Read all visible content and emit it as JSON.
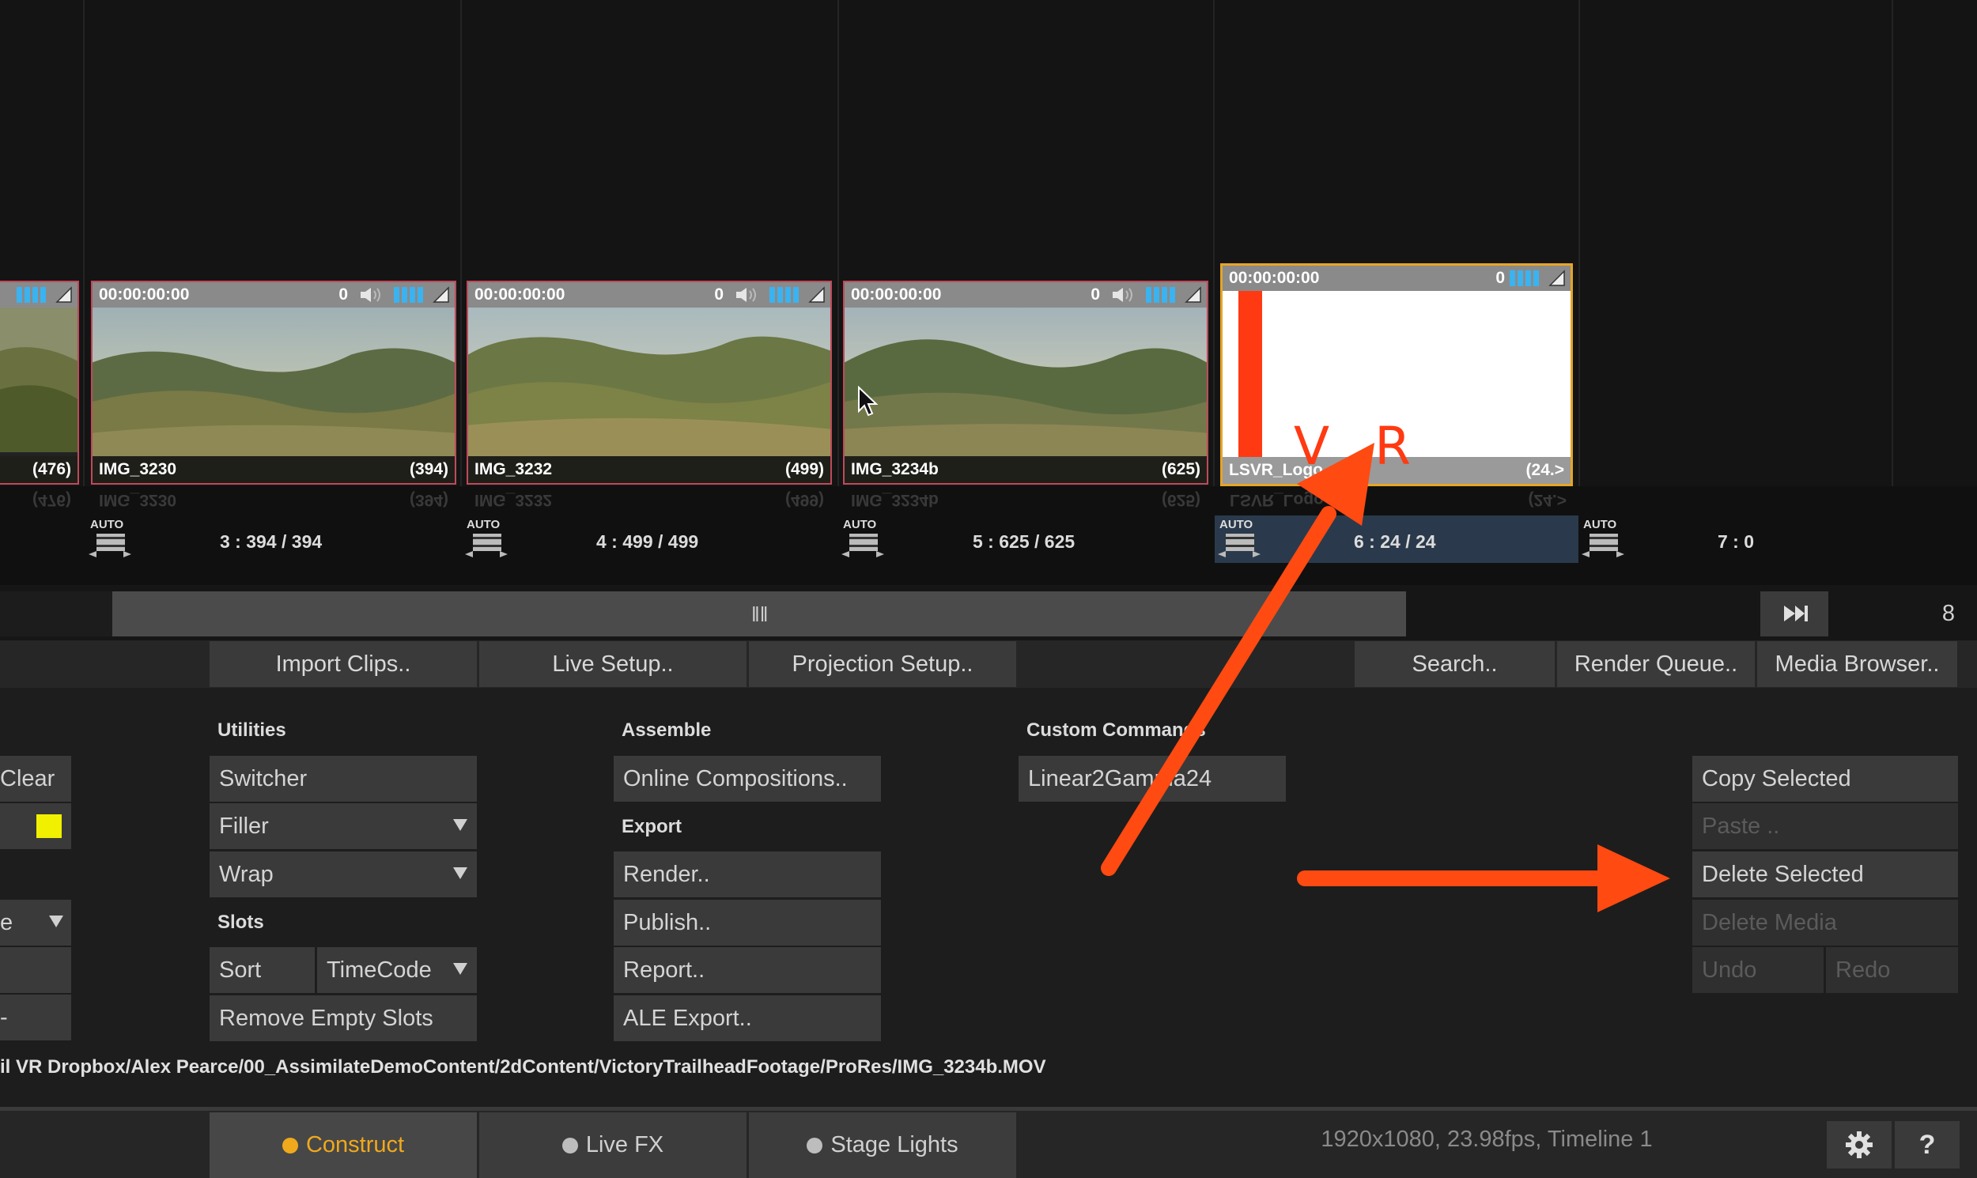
{
  "timeline": {
    "clips": [
      {
        "timecode": "",
        "zero": "",
        "name": "",
        "count": "(476)",
        "reflect_count": "(476)",
        "reflect_name": ""
      },
      {
        "timecode": "00:00:00:00",
        "zero": "0",
        "name": "IMG_3230",
        "count": "(394)",
        "reflect_name": "IMG_3230",
        "reflect_count": "(394)"
      },
      {
        "timecode": "00:00:00:00",
        "zero": "0",
        "name": "IMG_3232",
        "count": "(499)",
        "reflect_name": "IMG_3232",
        "reflect_count": "(499)"
      },
      {
        "timecode": "00:00:00:00",
        "zero": "0",
        "name": "IMG_3234b",
        "count": "(625)",
        "reflect_name": "IMG_3234b",
        "reflect_count": "(625)"
      },
      {
        "timecode": "00:00:00:00",
        "zero": "0",
        "name": "LSVR_Logo",
        "count": "(24.>",
        "reflect_name": "LSVR_Logo",
        "reflect_count": "(24.>"
      }
    ],
    "logo_text": "V R",
    "auto_label": "AUTO",
    "slots": [
      "3 : 394 / 394",
      "4 : 499 / 499",
      "5 : 625 / 625",
      "6 : 24 / 24",
      "7 : 0"
    ],
    "page_number": "8"
  },
  "toolbar": {
    "left": [
      "Import Clips..",
      "Live Setup..",
      "Projection Setup.."
    ],
    "right": [
      "Search..",
      "Render Queue..",
      "Media Browser.."
    ]
  },
  "panel": {
    "left_partial": {
      "clear": "Clear",
      "dropdown_partial": "e",
      "dash": "-"
    },
    "utilities": {
      "title": "Utilities",
      "switcher": "Switcher",
      "filler": "Filler",
      "wrap": "Wrap"
    },
    "slots": {
      "title": "Slots",
      "sort": "Sort",
      "timecode": "TimeCode",
      "remove_empty": "Remove Empty Slots"
    },
    "assemble": {
      "title": "Assemble",
      "online_compositions": "Online Compositions.."
    },
    "export": {
      "title": "Export",
      "render": "Render..",
      "publish": "Publish..",
      "report": "Report..",
      "ale_export": "ALE Export.."
    },
    "custom": {
      "title": "Custom Commands",
      "linear": "Linear2Gamma24"
    },
    "edit": {
      "copy_selected": "Copy Selected",
      "paste": "Paste ..",
      "delete_selected": "Delete Selected",
      "delete_media": "Delete Media",
      "undo": "Undo",
      "redo": "Redo"
    },
    "path": "il VR Dropbox/Alex Pearce/00_AssimilateDemoContent/2dContent/VictoryTrailheadFootage/ProRes/IMG_3234b.MOV"
  },
  "bottom": {
    "tabs": [
      "Construct",
      "Live FX",
      "Stage Lights"
    ],
    "status": "1920x1080, 23.98fps, Timeline 1",
    "help": "?"
  },
  "colors": {
    "accent": "#f0a91c",
    "selection_border": "#e5a528",
    "clip_border": "#c04a5a",
    "annotation_arrow": "#ff4a12",
    "audio_meter": "#3ab3f0",
    "swatch": "#f0f000"
  }
}
